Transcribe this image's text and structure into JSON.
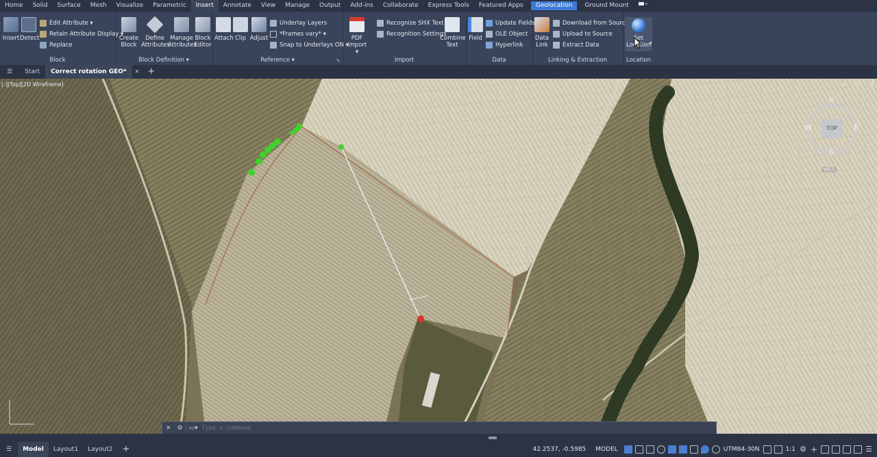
{
  "ribbon_tabs": [
    "Home",
    "Solid",
    "Surface",
    "Mesh",
    "Visualize",
    "Parametric",
    "Insert",
    "Annotate",
    "View",
    "Manage",
    "Output",
    "Add-ins",
    "Collaborate",
    "Express Tools",
    "Featured Apps",
    "Geolocation",
    "Ground Mount"
  ],
  "active_tab": "Insert",
  "panels": {
    "block": {
      "title": "Block",
      "insert": "Insert",
      "detect": "Detect",
      "edit_attribute": "Edit Attribute",
      "retain_attribute_display": "Retain Attribute Display",
      "replace": "Replace"
    },
    "block_definition": {
      "title": "Block Definition",
      "create_block_1": "Create",
      "create_block_2": "Block",
      "define_attributes_1": "Define",
      "define_attributes_2": "Attributes",
      "manage_attributes_1": "Manage",
      "manage_attributes_2": "Attributes",
      "block_editor_1": "Block",
      "block_editor_2": "Editor"
    },
    "reference": {
      "title": "Reference",
      "attach": "Attach",
      "clip": "Clip",
      "adjust": "Adjust",
      "underlay_layers": "Underlay Layers",
      "frames_vary": "*Frames vary*",
      "snap_to_underlays": "Snap to Underlays ON"
    },
    "import": {
      "title": "Import",
      "pdf_import_1": "PDF",
      "pdf_import_2": "Import",
      "recognize_shx": "Recognize SHX Text",
      "recognition_settings": "Recognition Settings",
      "combine_text_1": "Combine",
      "combine_text_2": "Text"
    },
    "data": {
      "title": "Data",
      "field": "Field",
      "update_fields": "Update Fields",
      "ole_object": "OLE Object",
      "hyperlink": "Hyperlink"
    },
    "linking": {
      "title": "Linking & Extraction",
      "data_link_1": "Data",
      "data_link_2": "Link",
      "download_from_source": "Download from Source",
      "upload_to_source": "Upload to Source",
      "extract_data": "Extract  Data"
    },
    "location": {
      "title": "Location",
      "set_location_1": "Set",
      "set_location_2": "Location"
    }
  },
  "doc_tabs": [
    "Start",
    "Correct rotation GEO*"
  ],
  "viewport_label": "[-][Top][2D Wireframe]",
  "viewcube": {
    "top": "TOP",
    "n": "N",
    "s": "S",
    "e": "E",
    "w": "W",
    "wcs": "WCS"
  },
  "command_placeholder": "Type a command",
  "layout_tabs": [
    "Model",
    "Layout1",
    "Layout2"
  ],
  "status": {
    "coordinates": "42.2537, -0.5985",
    "space": "MODEL",
    "coord_system": "UTM84-30N",
    "scale": "1:1"
  },
  "colors": {
    "ribbon_bg": "#39445a",
    "tabbar_bg": "#2b3344",
    "geolocation_tab": "#3d7ad6",
    "field_light": "#d8d2be",
    "field_dark": "#7a7356",
    "tree_green": "#41d12c",
    "marker_red": "#d33a2c"
  }
}
